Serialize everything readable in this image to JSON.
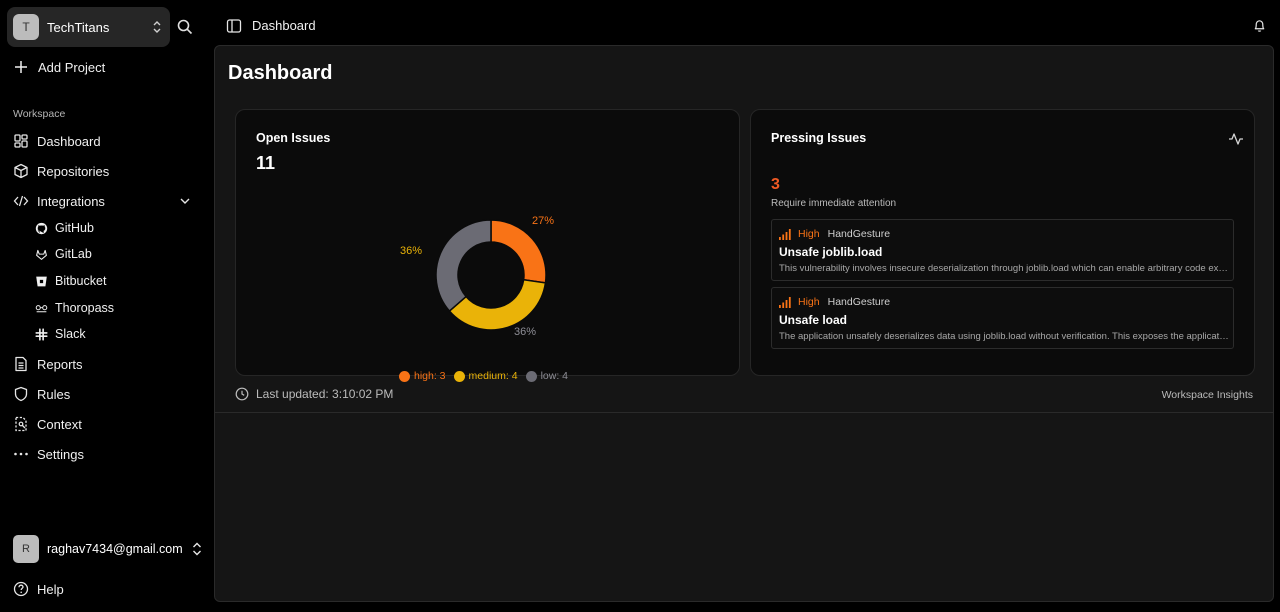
{
  "sidebar": {
    "org": {
      "initial": "T",
      "name": "TechTitans"
    },
    "add_project": "Add Project",
    "section_label": "Workspace",
    "items": [
      {
        "label": "Dashboard",
        "icon": "dashboard-icon"
      },
      {
        "label": "Repositories",
        "icon": "box-icon"
      },
      {
        "label": "Integrations",
        "icon": "code-icon"
      },
      {
        "label": "Reports",
        "icon": "document-icon"
      },
      {
        "label": "Rules",
        "icon": "shield-icon"
      },
      {
        "label": "Context",
        "icon": "file-dashed-icon"
      },
      {
        "label": "Settings",
        "icon": "ellipsis-icon"
      }
    ],
    "integrations": [
      {
        "label": "GitHub",
        "icon": "github-icon"
      },
      {
        "label": "GitLab",
        "icon": "gitlab-icon"
      },
      {
        "label": "Bitbucket",
        "icon": "bitbucket-icon"
      },
      {
        "label": "Thoropass",
        "icon": "thoropass-icon"
      },
      {
        "label": "Slack",
        "icon": "slack-icon"
      }
    ],
    "user": {
      "initial": "R",
      "email": "raghav7434@gmail.com"
    },
    "help": "Help"
  },
  "topbar": {
    "breadcrumb": "Dashboard"
  },
  "main": {
    "title": "Dashboard",
    "open_issues": {
      "title": "Open Issues",
      "count": "11",
      "legend": [
        {
          "label": "high: 3",
          "color": "#f97316"
        },
        {
          "label": "medium: 4",
          "color": "#eab308"
        },
        {
          "label": "low: 4",
          "color": "#6b6b74"
        }
      ]
    },
    "pressing": {
      "title": "Pressing Issues",
      "count": "3",
      "subtitle": "Require immediate attention",
      "issues": [
        {
          "severity": "High",
          "repo": "HandGesture",
          "title": "Unsafe joblib.load",
          "description": "This vulnerability involves insecure deserialization through joblib.load which can enable arbitrary code execution"
        },
        {
          "severity": "High",
          "repo": "HandGesture",
          "title": "Unsafe load",
          "description": "The application unsafely deserializes data using joblib.load without verification. This exposes the application to attacks"
        }
      ]
    },
    "last_updated": "Last updated: 3:10:02 PM",
    "insights_link": "Workspace Insights"
  },
  "chart_data": {
    "type": "pie",
    "title": "",
    "categories": [
      "high",
      "medium",
      "low"
    ],
    "values": [
      3,
      4,
      4
    ],
    "percent_labels": [
      "27%",
      "36%",
      "36%"
    ],
    "colors": [
      "#f97316",
      "#eab308",
      "#6b6b74"
    ],
    "donut": true,
    "legend_position": "bottom"
  }
}
